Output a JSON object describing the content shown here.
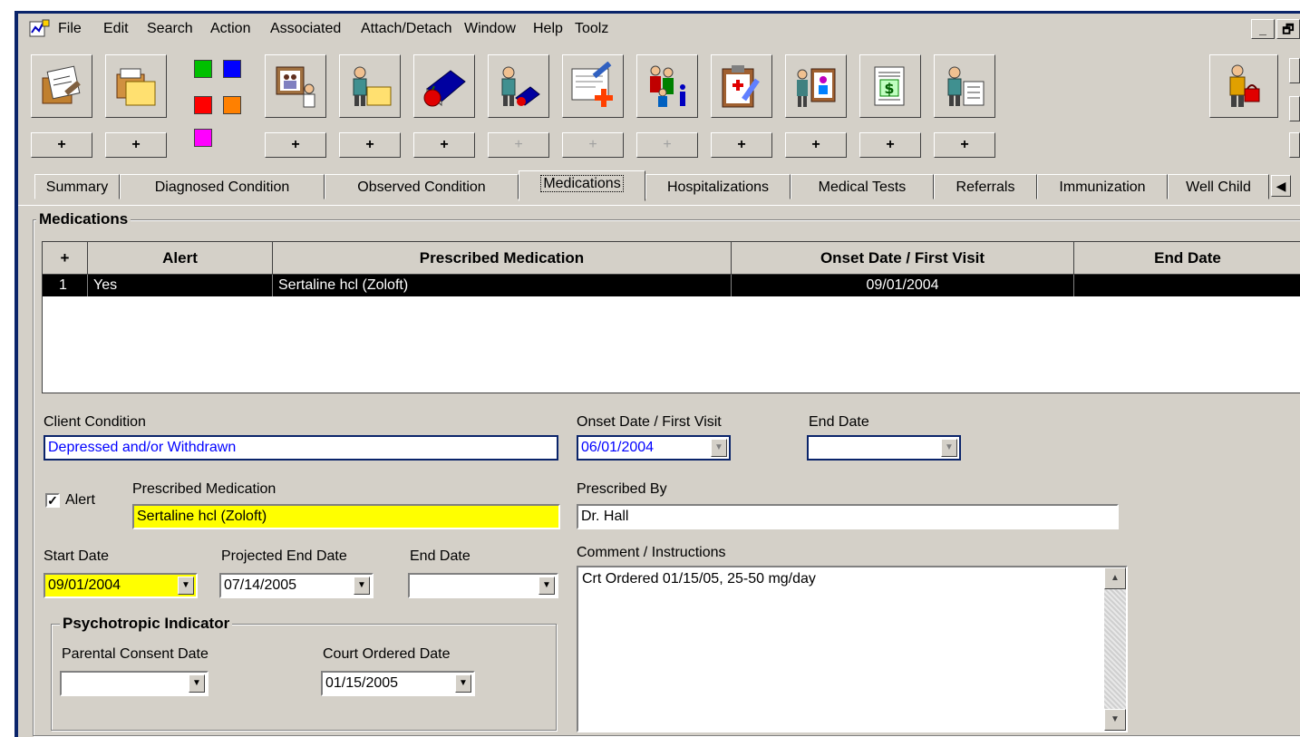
{
  "menubar": {
    "items": [
      "File",
      "Edit",
      "Search",
      "Action",
      "Associated",
      "Attach/Detach",
      "Window",
      "Help",
      "Toolz"
    ],
    "window_buttons": [
      "_",
      "🗗"
    ]
  },
  "toolbar": {
    "plus_label": "+",
    "colors": {
      "green": "#00c000",
      "blue": "#0000ff",
      "red": "#ff0000",
      "orange": "#ff8000",
      "magenta": "#ff00ff"
    },
    "icons": [
      "notes-icon",
      "folders-icon",
      "color-swatch-icon",
      "family-photo-icon",
      "person-folder-icon",
      "book-apple-icon",
      "teacher-book-icon",
      "add-note-icon",
      "family-info-icon",
      "medical-clipboard-icon",
      "person-board-icon",
      "finance-sheet-icon",
      "person-list-icon",
      "person-bag-icon"
    ]
  },
  "tabs": [
    {
      "label": "Summary",
      "active": false
    },
    {
      "label": "Diagnosed Condition",
      "active": false
    },
    {
      "label": "Observed Condition",
      "active": false
    },
    {
      "label": "Medications",
      "active": true
    },
    {
      "label": "Hospitalizations",
      "active": false
    },
    {
      "label": "Medical Tests",
      "active": false
    },
    {
      "label": "Referrals",
      "active": false
    },
    {
      "label": "Immunization",
      "active": false
    },
    {
      "label": "Well Child",
      "active": false
    }
  ],
  "medications": {
    "group_title": "Medications",
    "columns": [
      "+",
      "Alert",
      "Prescribed Medication",
      "Onset Date / First Visit",
      "End Date"
    ],
    "rows": [
      {
        "num": "1",
        "alert": "Yes",
        "medication": "Sertaline hcl (Zoloft)",
        "onset": "09/01/2004",
        "end": ""
      }
    ]
  },
  "form": {
    "client_condition_label": "Client Condition",
    "client_condition_value": "Depressed and/or Withdrawn",
    "onset_label": "Onset Date / First Visit",
    "onset_value": "06/01/2004",
    "end_date_label": "End Date",
    "end_date_value": "",
    "alert_label": "Alert",
    "alert_checked": true,
    "check_mark": "✓",
    "prescribed_med_label": "Prescribed Medication",
    "prescribed_med_value": "Sertaline hcl (Zoloft)",
    "prescribed_by_label": "Prescribed By",
    "prescribed_by_value": "Dr. Hall",
    "start_date_label": "Start Date",
    "start_date_value": "09/01/2004",
    "proj_end_label": "Projected End Date",
    "proj_end_value": "07/14/2005",
    "end_date2_label": "End Date",
    "end_date2_value": "",
    "comment_label": "Comment / Instructions",
    "comment_value": "Crt Ordered 01/15/05, 25-50 mg/day",
    "psych_title": "Psychotropic Indicator",
    "parental_label": "Parental Consent Date",
    "parental_value": "",
    "court_label": "Court Ordered Date",
    "court_value": "01/15/2005"
  }
}
